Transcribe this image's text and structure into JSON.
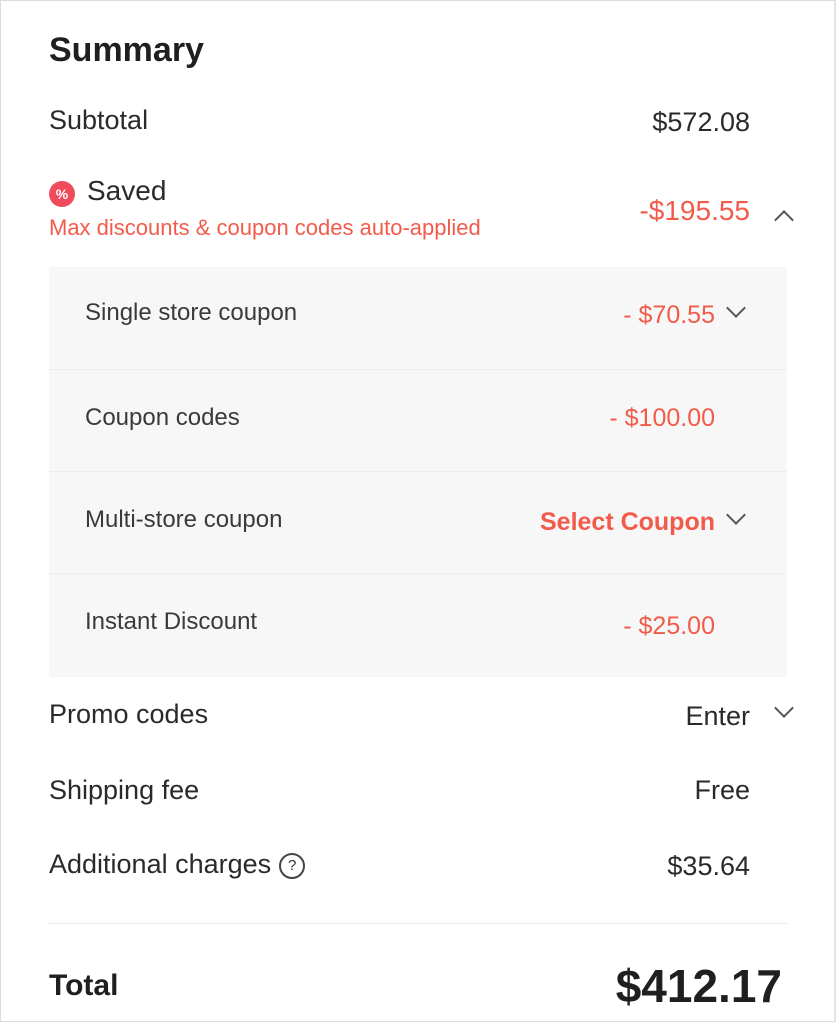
{
  "summary": {
    "title": "Summary",
    "subtotal": {
      "label": "Subtotal",
      "value": "$572.08"
    },
    "saved": {
      "icon": "discount-badge-icon",
      "icon_glyph": "%",
      "label": "Saved",
      "subtext": "Max discounts & coupon codes auto-applied",
      "value": "-$195.55",
      "expanded": true,
      "accent": "#f25b4a"
    },
    "breakdown": [
      {
        "label": "Single store coupon",
        "value": "- $70.55",
        "has_dropdown": true
      },
      {
        "label": "Coupon codes",
        "value": "- $100.00",
        "has_dropdown": false
      },
      {
        "label": "Multi-store coupon",
        "value": "Select Coupon",
        "has_dropdown": true
      },
      {
        "label": "Instant Discount",
        "value": "- $25.00",
        "has_dropdown": false
      }
    ],
    "promo": {
      "label": "Promo codes",
      "value": "Enter"
    },
    "shipping": {
      "label": "Shipping fee",
      "value": "Free"
    },
    "additional": {
      "label": "Additional charges",
      "help_glyph": "?",
      "value": "$35.64"
    },
    "total": {
      "label": "Total",
      "value": "$412.17"
    }
  }
}
